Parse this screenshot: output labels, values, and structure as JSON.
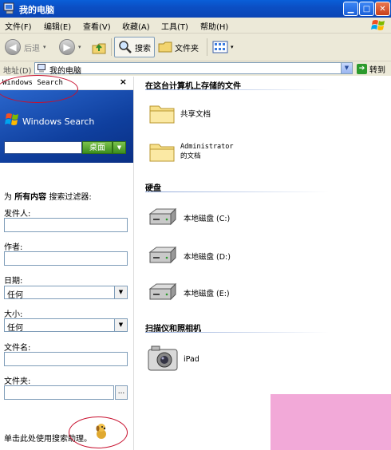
{
  "window": {
    "title": "我的电脑"
  },
  "menu": [
    "文件(F)",
    "编辑(E)",
    "查看(V)",
    "收藏(A)",
    "工具(T)",
    "帮助(H)"
  ],
  "toolbar": {
    "back": "后退",
    "search": "搜索",
    "folders": "文件夹"
  },
  "address": {
    "label": "地址(D)",
    "value": "我的电脑",
    "go": "转到"
  },
  "left_pane": {
    "title": "Windows Search",
    "close": "×",
    "brand": "Windows Search",
    "scope_button": "桌面",
    "filter_prefix": "为",
    "filter_bold": "所有内容",
    "filter_suffix": "搜索过滤器:",
    "fields": {
      "sender_label": "发件人:",
      "author_label": "作者:",
      "date_label": "日期:",
      "date_value": "任何",
      "size_label": "大小:",
      "size_value": "任何",
      "filename_label": "文件名:",
      "folder_label": "文件夹:",
      "browse": "..."
    },
    "assistant_text": "单击此处使用搜索助理。"
  },
  "right_pane": {
    "section_files": "在这台计算机上存储的文件",
    "files": [
      {
        "label": "共享文档"
      },
      {
        "label": "Administrator 的文档"
      }
    ],
    "section_drives": "硬盘",
    "drives": [
      {
        "label": "本地磁盘 (C:)"
      },
      {
        "label": "本地磁盘 (D:)"
      },
      {
        "label": "本地磁盘 (E:)"
      }
    ],
    "section_scanners": "扫描仪和照相机",
    "devices": [
      {
        "label": "iPad"
      }
    ]
  },
  "colors": {
    "titlebar": "#0a4fc4",
    "chrome": "#ece9d8",
    "annotation": "#c8102e",
    "overlay": "#f2a9d8"
  }
}
